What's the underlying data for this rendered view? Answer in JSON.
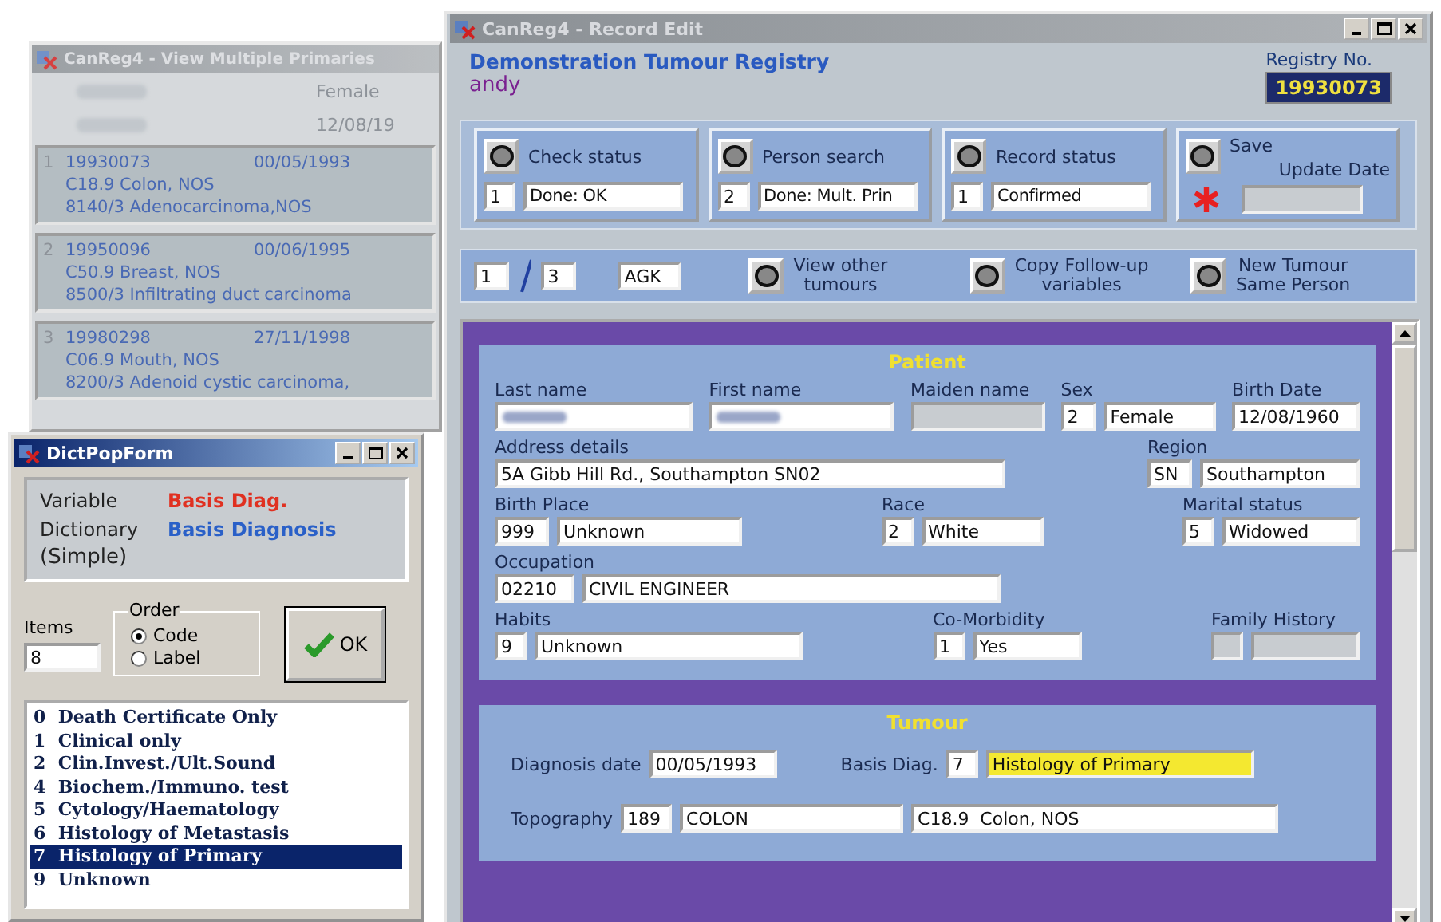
{
  "primaries_window": {
    "title": "CanReg4 - View Multiple Primaries",
    "sex": "Female",
    "birth_date": "12/08/19",
    "tumours": [
      {
        "index": "1",
        "registry_no": "19930073",
        "date": "00/05/1993",
        "topography": "C18.9  Colon, NOS",
        "morphology": "8140/3  Adenocarcinoma,NOS"
      },
      {
        "index": "2",
        "registry_no": "19950096",
        "date": "00/06/1995",
        "topography": "C50.9  Breast, NOS",
        "morphology": "8500/3  Infiltrating duct carcinoma"
      },
      {
        "index": "3",
        "registry_no": "19980298",
        "date": "27/11/1998",
        "topography": "C06.9  Mouth, NOS",
        "morphology": "8200/3  Adenoid cystic carcinoma,"
      }
    ]
  },
  "dict_window": {
    "title": "DictPopForm",
    "variable_label": "Variable",
    "variable": "Basis Diag.",
    "dictionary_label": "Dictionary",
    "dictionary": "Basis Diagnosis",
    "type": "(Simple)",
    "items_label": "Items",
    "items": "8",
    "order_label": "Order",
    "order_options": [
      {
        "label": "Code",
        "selected": true
      },
      {
        "label": "Label",
        "selected": false
      }
    ],
    "ok_button": "OK",
    "entries": [
      {
        "code": "0",
        "label": "Death Certificate Only",
        "selected": false
      },
      {
        "code": "1",
        "label": "Clinical only",
        "selected": false
      },
      {
        "code": "2",
        "label": "Clin.Invest./Ult.Sound",
        "selected": false
      },
      {
        "code": "4",
        "label": "Biochem./Immuno. test",
        "selected": false
      },
      {
        "code": "5",
        "label": "Cytology/Haematology",
        "selected": false
      },
      {
        "code": "6",
        "label": "Histology of Metastasis",
        "selected": false
      },
      {
        "code": "7",
        "label": "Histology of Primary",
        "selected": true
      },
      {
        "code": "9",
        "label": "Unknown",
        "selected": false
      }
    ]
  },
  "record_window": {
    "title": "CanReg4 - Record Edit",
    "registry_name": "Demonstration Tumour Registry",
    "user": "andy",
    "registry_no_label": "Registry No.",
    "registry_no": "19930073",
    "status_panels": [
      {
        "kind": "status",
        "button_label": "Check status",
        "code": "1",
        "value": "Done: OK"
      },
      {
        "kind": "status",
        "button_label": "Person search",
        "code": "2",
        "value": "Done: Mult. Prin"
      },
      {
        "kind": "status",
        "button_label": "Record status",
        "code": "1",
        "value": "Confirmed"
      },
      {
        "kind": "save",
        "button_label": "Save",
        "field_label": "Update Date",
        "modified": true
      }
    ],
    "navigation": {
      "current": "1",
      "total": "3",
      "initials": "AGK",
      "buttons": [
        {
          "lines": [
            "View other",
            "tumours"
          ]
        },
        {
          "lines": [
            "Copy Follow-up",
            "variables"
          ]
        },
        {
          "lines": [
            "New Tumour",
            "Same Person"
          ]
        }
      ]
    },
    "sections": [
      {
        "title": "Patient",
        "kind": "stacked",
        "rows": [
          {
            "fields": [
              {
                "kind": "blurred",
                "label": "Last name"
              },
              {
                "kind": "blurred",
                "label": "First name"
              },
              {
                "kind": "text",
                "label": "Maiden name",
                "disabled": true
              },
              {
                "kind": "coded",
                "label": "Sex",
                "code": "2",
                "value": "Female"
              },
              {
                "kind": "text",
                "label": "Birth Date",
                "value": "12/08/1960"
              }
            ]
          },
          {
            "fields": [
              {
                "kind": "text",
                "label": "Address details",
                "value": "5A Gibb Hill Rd., Southampton SN02"
              },
              {
                "kind": "coded",
                "label": "Region",
                "code": "SN",
                "value": "Southampton"
              }
            ]
          },
          {
            "fields": [
              {
                "kind": "coded",
                "label": "Birth Place",
                "code": "999",
                "value": "Unknown"
              },
              {
                "kind": "coded",
                "label": "Race",
                "code": "2",
                "value": "White"
              },
              {
                "kind": "coded",
                "label": "Marital status",
                "code": "5",
                "value": "Widowed"
              }
            ]
          },
          {
            "fields": [
              {
                "kind": "coded",
                "label": "Occupation",
                "code": "02210",
                "value": "CIVIL ENGINEER"
              }
            ]
          },
          {
            "fields": [
              {
                "kind": "coded",
                "label": "Habits",
                "code": "9",
                "value": "Unknown"
              },
              {
                "kind": "coded",
                "label": "Co-Morbidity",
                "code": "1",
                "value": "Yes"
              },
              {
                "kind": "coded",
                "label": "Family History",
                "disabled": true
              }
            ]
          }
        ]
      },
      {
        "title": "Tumour",
        "kind": "inline",
        "rows": [
          {
            "fields": [
              {
                "kind": "text",
                "label": "Diagnosis date",
                "value": "00/05/1993"
              },
              {
                "kind": "coded",
                "label": "Basis Diag.",
                "code": "7",
                "value": "Histology of Primary",
                "highlighted": true
              }
            ]
          },
          {
            "fields": [
              {
                "kind": "coded",
                "label": "Topography",
                "code": "189",
                "value": "COLON",
                "description": "C18.9  Colon, NOS"
              }
            ]
          }
        ]
      }
    ]
  }
}
